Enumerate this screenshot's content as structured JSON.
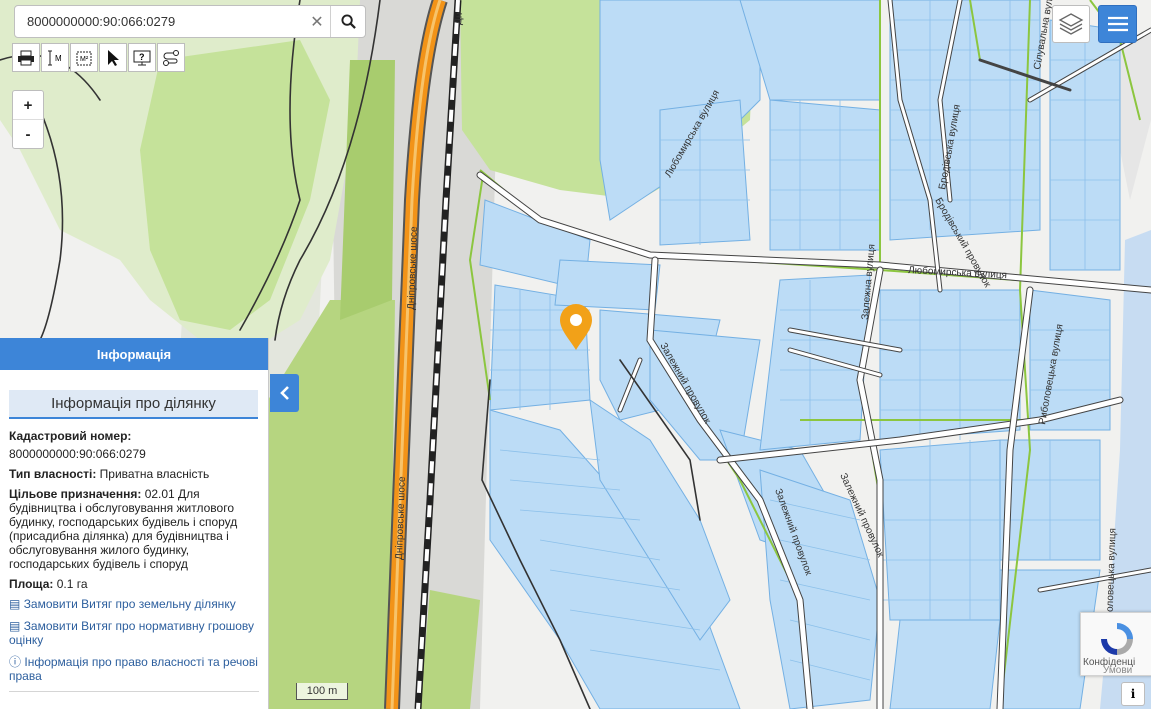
{
  "search": {
    "value": "8000000000:90:066:0279"
  },
  "toolbar": {
    "tools": [
      "print-icon",
      "measure-length-icon",
      "measure-area-icon",
      "select-pointer-icon",
      "identify-icon",
      "route-icon"
    ],
    "m_label": "M",
    "m2_label": "M²"
  },
  "zoom": {
    "in_label": "+",
    "out_label": "-"
  },
  "map": {
    "street_labels": {
      "highway1": "Дніпровське шосе",
      "highway2": "Дніпровське шосе",
      "lubomyrska_diag": "Любомирська вулиця",
      "lubomyrska": "Любомирська вулиця",
      "brodivska1": "Бродівська вулиця",
      "brodivska2": "Бродівський провулок",
      "zalizhna1": "Залежний провулок",
      "zalizhna2": "Залежний провулок",
      "zalizhna3": "Залежний провулок",
      "zalizhna4": "Залежна вулиця",
      "ribolovetska1": "Риболовецька вулиця",
      "ribolovetska2": "Риболовецька вулиця",
      "top_right": "Сілувальна вулиця",
      "top_hwy": "Дн"
    },
    "marker_color": "#f2a118"
  },
  "panel": {
    "header": "Інформація",
    "subheader": "Інформація про ділянку",
    "cadastral_label": "Кадастровий номер:",
    "cadastral_value": "8000000000:90:066:0279",
    "ownership_label": "Тип власності:",
    "ownership_value": "Приватна власність",
    "purpose_label": "Цільове призначення:",
    "purpose_value": "02.01 Для будівництва і обслуговування житлового будинку, господарських будівель і споруд (присадибна ділянка) для будівництва і обслуговування жилого будинку, господарських будівель і споруд",
    "area_label": "Площа:",
    "area_value": "0.1 га",
    "link1": "Замовити Витяг про земельну ділянку",
    "link2": "Замовити Витяг про нормативну грошову оцінку",
    "link3": "Інформація про право власності та речові права"
  },
  "scale_label": "100 m",
  "recaptcha": {
    "text1": "Конфіденці",
    "text2": "Умови"
  },
  "info_button": "i",
  "colors": {
    "accent": "#3d85d8",
    "parcel_fill": "#bcdcf6",
    "parcel_stroke": "#74b0e3",
    "forest": "#c5e29a",
    "road_orange": "#f29318",
    "boundary_green": "#8cc63f"
  }
}
